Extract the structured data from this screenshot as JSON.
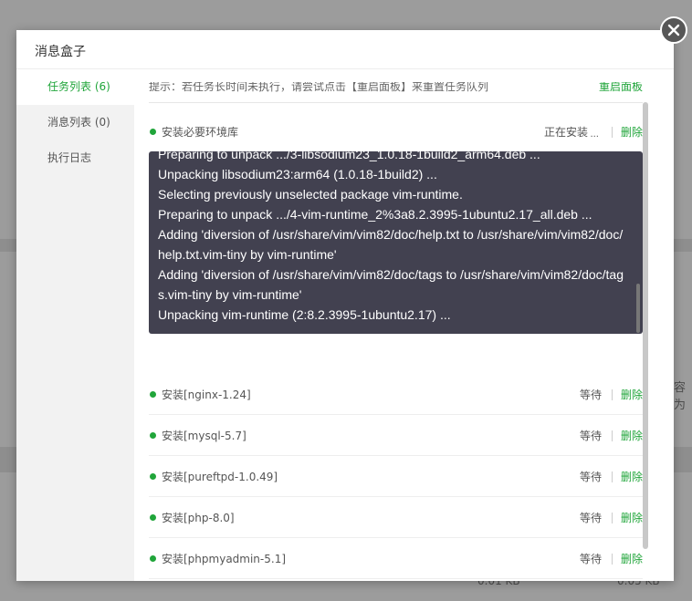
{
  "modal": {
    "title": "消息盒子"
  },
  "sidebar": {
    "items": [
      {
        "label": "任务列表 (6)",
        "active": true
      },
      {
        "label": "消息列表 (0)",
        "active": false
      },
      {
        "label": "执行日志",
        "active": false
      }
    ]
  },
  "hint": {
    "text": "提示：若任务长时间未执行，请尝试点击【重启面板】来重置任务队列",
    "link": "重启面板"
  },
  "current_task": {
    "name": "安装必要环境库",
    "status": "正在安装",
    "status_suffix": "...",
    "delete": "删除",
    "log": [
      "Preparing to unpack .../3-libsodium23_1.0.18-1build2_arm64.deb ...",
      "Unpacking libsodium23:arm64 (1.0.18-1build2) ...",
      "Selecting previously unselected package vim-runtime.",
      "Preparing to unpack .../4-vim-runtime_2%3a8.2.3995-1ubuntu2.17_all.deb ...",
      "Adding 'diversion of /usr/share/vim/vim82/doc/help.txt to /usr/share/vim/vim82/doc/help.txt.vim-tiny by vim-runtime'",
      "Adding 'diversion of /usr/share/vim/vim82/doc/tags to /usr/share/vim/vim82/doc/tags.vim-tiny by vim-runtime'",
      "Unpacking vim-runtime (2:8.2.3995-1ubuntu2.17) ..."
    ]
  },
  "tasks": [
    {
      "name": "安装[nginx-1.24]",
      "status": "等待",
      "delete": "删除"
    },
    {
      "name": "安装[mysql-5.7]",
      "status": "等待",
      "delete": "删除"
    },
    {
      "name": "安装[pureftpd-1.0.49]",
      "status": "等待",
      "delete": "删除"
    },
    {
      "name": "安装[php-8.0]",
      "status": "等待",
      "delete": "删除"
    },
    {
      "name": "安装[phpmyadmin-5.1]",
      "status": "等待",
      "delete": "删除"
    }
  ],
  "background": {
    "right_text": "容为",
    "foot1": "0.01 KB",
    "foot2": "0.05 KB"
  },
  "colors": {
    "accent": "#20a53a",
    "log_bg": "#424150",
    "overlay": "#9c9c9c"
  },
  "icons": {
    "close": "close-icon",
    "status_dot": "dot-icon"
  }
}
